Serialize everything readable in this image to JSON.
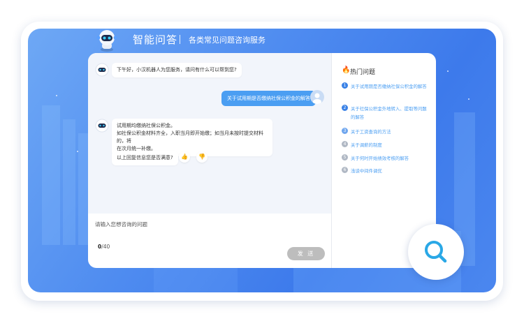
{
  "header": {
    "title": "智能问答",
    "subtitle": "各类常见问题咨询服务"
  },
  "chat": {
    "greeting": "下午好，小汉机器人为您服务，请问有什么可以帮到您?",
    "user_message": "关于试用期是否缴纳社保公积金的解答",
    "bot_answer_line1": "试用期均缴纳社保公积金。",
    "bot_answer_line2": "如社保公积金材料齐全，入职当月即开始缴；如当月未按时提交材料的，将",
    "bot_answer_line3": "在次月统一补缴。",
    "feedback_question": "以上回复信息您是否满意?"
  },
  "input": {
    "placeholder": "请输入您想咨询的问题",
    "count_current": "0",
    "count_max": "/40",
    "send_label": "发 送"
  },
  "hot": {
    "title": "热门问题",
    "items": [
      {
        "num": "1",
        "text": "关于试用期是否缴纳社保公积金的解答",
        "color": "#3b82e6"
      },
      {
        "num": "2",
        "text": "关于社保公积金外地转入、提取等问题的解答",
        "color": "#3b82e6"
      },
      {
        "num": "3",
        "text": "关于工资查询的方法",
        "color": "#6fa6ee"
      },
      {
        "num": "4",
        "text": "关于调薪的制度",
        "color": "#b0b8c4"
      },
      {
        "num": "5",
        "text": "关于何时开始绩效考核的解答",
        "color": "#b0b8c4"
      },
      {
        "num": "6",
        "text": "浅谈中间件调优",
        "color": "#b0b8c4"
      }
    ]
  },
  "colors": {
    "accent": "#4b9ef2",
    "send_disabled": "#bdbdbd",
    "banner": "#4f8cf0"
  }
}
